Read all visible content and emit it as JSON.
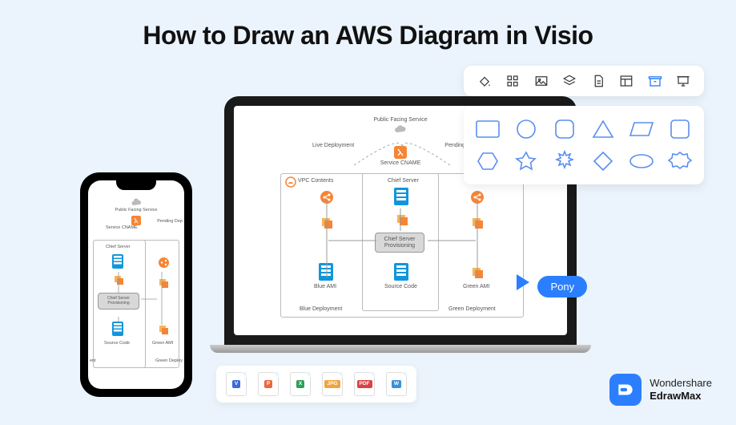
{
  "title": "How to Draw an AWS Diagram in Visio",
  "cursor_label": "Pony",
  "brand": {
    "line1": "Wondershare",
    "line2": "EdrawMax"
  },
  "file_formats": [
    {
      "label": "V",
      "color": "#3b6bd6"
    },
    {
      "label": "P",
      "color": "#e9683c"
    },
    {
      "label": "X",
      "color": "#2e9e5b"
    },
    {
      "label": "JPG",
      "color": "#f0a53c"
    },
    {
      "label": "PDF",
      "color": "#d84444"
    },
    {
      "label": "W",
      "color": "#3b8fd6"
    }
  ],
  "toolbar_icons": [
    "fill-icon",
    "grid-icon",
    "image-icon",
    "layers-icon",
    "page-icon",
    "layout-icon",
    "archive-icon",
    "presentation-icon"
  ],
  "diagram": {
    "public_facing": "Public Facing Service",
    "live_deploy": "Live Deployment",
    "pending_deploy": "Pending D",
    "pending_deploy_phone": "Pending Dep",
    "service_cname": "Service CNAME",
    "vpc_contents": "VPC Contents",
    "chief_server": "Chief Server",
    "chief_server_prov": "Chief Server Provisioning",
    "blue_ami": "Blue AMI",
    "source_code": "Source Code",
    "green_ami": "Green AMI",
    "blue_deploy": "Blue Deployment",
    "green_deploy": "Green Deployment",
    "green_deploy_phone": "Green Deploy",
    "ent": "ent"
  }
}
